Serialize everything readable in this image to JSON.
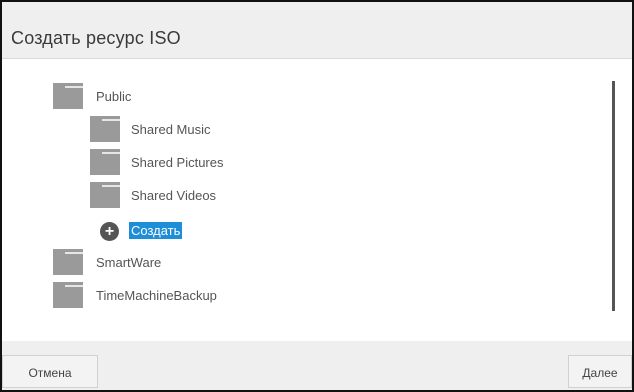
{
  "dialog": {
    "title": "Создать ресурс ISO"
  },
  "tree": {
    "items": [
      {
        "label": "Public",
        "icon": "folder-icon"
      },
      {
        "label": "Shared Music",
        "icon": "folder-icon"
      },
      {
        "label": "Shared Pictures",
        "icon": "folder-icon"
      },
      {
        "label": "Shared Videos",
        "icon": "folder-icon"
      },
      {
        "label": "Создать",
        "icon": "plus-circle-icon"
      },
      {
        "label": "SmartWare",
        "icon": "folder-icon"
      },
      {
        "label": "TimeMachineBackup",
        "icon": "folder-icon"
      }
    ]
  },
  "footer": {
    "cancel_label": "Отмена",
    "next_label": "Далее"
  },
  "colors": {
    "header_bg": "#efefef",
    "folder": "#9a9a9a",
    "selection": "#1f8ed8"
  }
}
